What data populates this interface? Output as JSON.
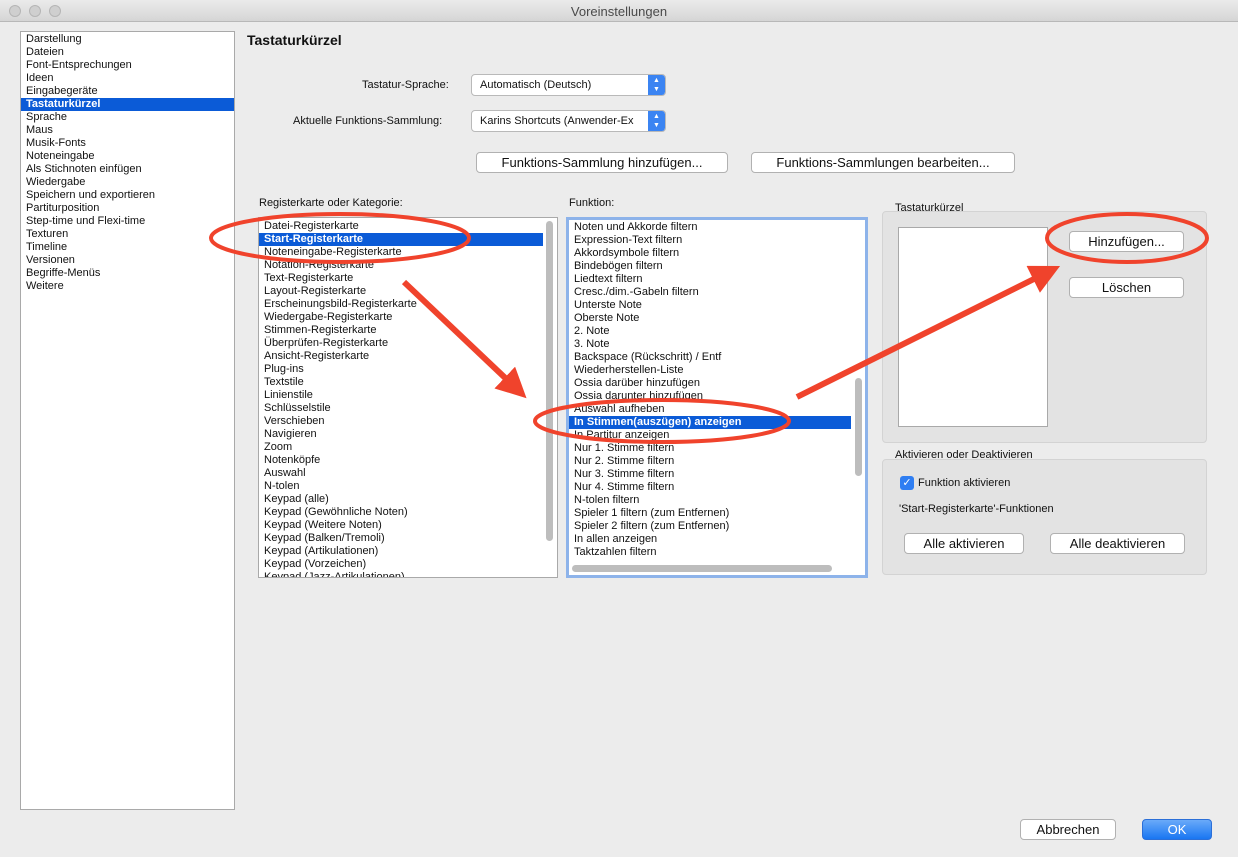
{
  "window": {
    "title": "Voreinstellungen"
  },
  "sidebar": {
    "items": [
      "Darstellung",
      "Dateien",
      "Font-Entsprechungen",
      "Ideen",
      "Eingabegeräte",
      "Tastaturkürzel",
      "Sprache",
      "Maus",
      "Musik-Fonts",
      "Noteneingabe",
      "Als Stichnoten einfügen",
      "Wiedergabe",
      "Speichern und exportieren",
      "Partiturposition",
      "Step-time und Flexi-time",
      "Texturen",
      "Timeline",
      "Versionen",
      "Begriffe-Menüs",
      "Weitere"
    ],
    "selected": "Tastaturkürzel"
  },
  "pane": {
    "title": "Tastaturkürzel",
    "keyboard_language_label": "Tastatur-Sprache:",
    "keyboard_language_value": "Automatisch (Deutsch)",
    "collection_label": "Aktuelle Funktions-Sammlung:",
    "collection_value": "Karins Shortcuts (Anwender-Ex",
    "add_collection_button": "Funktions-Sammlung hinzufügen...",
    "edit_collections_button": "Funktions-Sammlungen bearbeiten..."
  },
  "categories": {
    "label": "Registerkarte oder Kategorie:",
    "items": [
      "Datei-Registerkarte",
      "Start-Registerkarte",
      "Noteneingabe-Registerkarte",
      "Notation-Registerkarte",
      "Text-Registerkarte",
      "Layout-Registerkarte",
      "Erscheinungsbild-Registerkarte",
      "Wiedergabe-Registerkarte",
      "Stimmen-Registerkarte",
      "Überprüfen-Registerkarte",
      "Ansicht-Registerkarte",
      "Plug-ins",
      "Textstile",
      "Linienstile",
      "Schlüsselstile",
      "Verschieben",
      "Navigieren",
      "Zoom",
      "Notenköpfe",
      "Auswahl",
      "N-tolen",
      "Keypad (alle)",
      "Keypad (Gewöhnliche Noten)",
      "Keypad (Weitere Noten)",
      "Keypad (Balken/Tremoli)",
      "Keypad (Artikulationen)",
      "Keypad (Vorzeichen)",
      "Keypad (Jazz-Artikulationen)"
    ],
    "selected": "Start-Registerkarte"
  },
  "functions": {
    "label": "Funktion:",
    "items": [
      "Noten und Akkorde filtern",
      "Expression-Text filtern",
      "Akkordsymbole filtern",
      "Bindebögen filtern",
      "Liedtext filtern",
      "Cresc./dim.-Gabeln filtern",
      "Unterste Note",
      "Oberste Note",
      "2. Note",
      "3. Note",
      "Backspace (Rückschritt) / Entf",
      "Wiederherstellen-Liste",
      "Ossia darüber hinzufügen",
      "Ossia darunter hinzufügen",
      "Auswahl aufheben",
      "In Stimmen(auszügen) anzeigen",
      "In Partitur anzeigen",
      "Nur 1. Stimme filtern",
      "Nur 2. Stimme filtern",
      "Nur 3. Stimme filtern",
      "Nur 4. Stimme filtern",
      "N-tolen filtern",
      "Spieler 1 filtern (zum Entfernen)",
      "Spieler 2 filtern (zum Entfernen)",
      "In allen anzeigen",
      "Taktzahlen filtern"
    ],
    "selected": "In Stimmen(auszügen) anzeigen"
  },
  "shortcuts": {
    "group_label": "Tastaturkürzel",
    "add_button": "Hinzufügen...",
    "delete_button": "Löschen"
  },
  "activation": {
    "group_label": "Aktivieren oder Deaktivieren",
    "checkbox_label": "Funktion aktivieren",
    "checkbox_checked": true,
    "scope_text": "'Start-Registerkarte'-Funktionen",
    "activate_all_button": "Alle aktivieren",
    "deactivate_all_button": "Alle deaktivieren"
  },
  "footer": {
    "cancel_button": "Abbrechen",
    "ok_button": "OK"
  },
  "colors": {
    "selection": "#0b5bd7",
    "annotation": "#f0432c",
    "accent": "#3b84f2"
  }
}
